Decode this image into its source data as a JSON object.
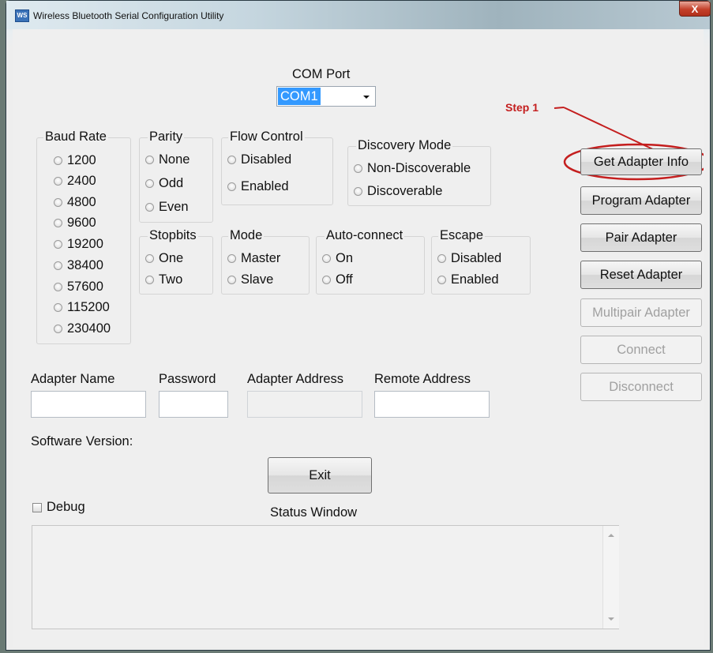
{
  "window": {
    "title": "Wireless Bluetooth Serial Configuration Utility",
    "close_glyph": "X",
    "icon_glyph": "WS"
  },
  "com_port": {
    "label": "COM Port",
    "selected": "COM1"
  },
  "annotation": {
    "text": "Step 1",
    "color": "#c41e1e"
  },
  "baud": {
    "title": "Baud Rate",
    "options": [
      "1200",
      "2400",
      "4800",
      "9600",
      "19200",
      "38400",
      "57600",
      "115200",
      "230400"
    ]
  },
  "parity": {
    "title": "Parity",
    "options": [
      "None",
      "Odd",
      "Even"
    ]
  },
  "flow": {
    "title": "Flow Control",
    "options": [
      "Disabled",
      "Enabled"
    ]
  },
  "discovery": {
    "title": "Discovery Mode",
    "options": [
      "Non-Discoverable",
      "Discoverable"
    ]
  },
  "stopbits": {
    "title": "Stopbits",
    "options": [
      "One",
      "Two"
    ]
  },
  "mode": {
    "title": "Mode",
    "options": [
      "Master",
      "Slave"
    ]
  },
  "autoconnect": {
    "title": "Auto-connect",
    "options": [
      "On",
      "Off"
    ]
  },
  "escape": {
    "title": "Escape",
    "options": [
      "Disabled",
      "Enabled"
    ]
  },
  "buttons": {
    "get_info": "Get Adapter Info",
    "program": "Program Adapter",
    "pair": "Pair Adapter",
    "reset": "Reset Adapter",
    "multipair": "Multipair Adapter",
    "connect": "Connect",
    "disconnect": "Disconnect",
    "exit": "Exit"
  },
  "fields": {
    "adapter_name": {
      "label": "Adapter Name",
      "value": ""
    },
    "password": {
      "label": "Password",
      "value": ""
    },
    "adapter_address": {
      "label": "Adapter Address",
      "value": ""
    },
    "remote_address": {
      "label": "Remote Address",
      "value": ""
    }
  },
  "software_version": {
    "label": "Software Version:"
  },
  "debug": {
    "label": "Debug",
    "checked": false
  },
  "status": {
    "label": "Status Window",
    "text": ""
  }
}
